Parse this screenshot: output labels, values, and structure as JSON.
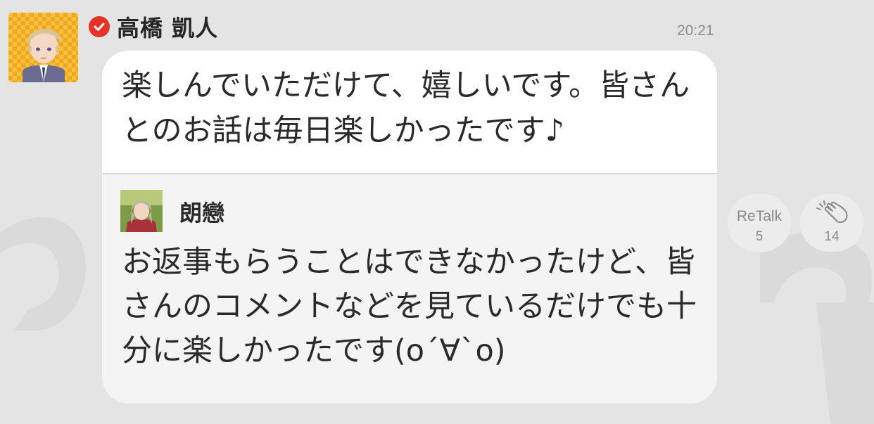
{
  "post": {
    "sender_name": "高橋 凱人",
    "timestamp": "20:21",
    "message": "楽しんでいただけて、嬉しいです。皆さんとのお話は毎日楽しかったです♪",
    "sender_avatar_icon": "character-avatar",
    "verified_icon": "verified-check-icon"
  },
  "quote": {
    "name": "朗戀",
    "text": "お返事もらうことはできなかったけど、皆さんのコメントなどを見ているだけでも十分に楽しかったです(o´∀`o)",
    "avatar_icon": "character-avatar"
  },
  "actions": {
    "retalk_label": "ReTalk",
    "retalk_count": "5",
    "clap_icon": "clap-icon",
    "clap_count": "14"
  },
  "colors": {
    "background": "#e4e4e4",
    "verified_badge": "#e6332a",
    "bubble_top": "#ffffff",
    "bubble_quote": "#f4f4f4",
    "muted_text": "#8a8a8a"
  }
}
